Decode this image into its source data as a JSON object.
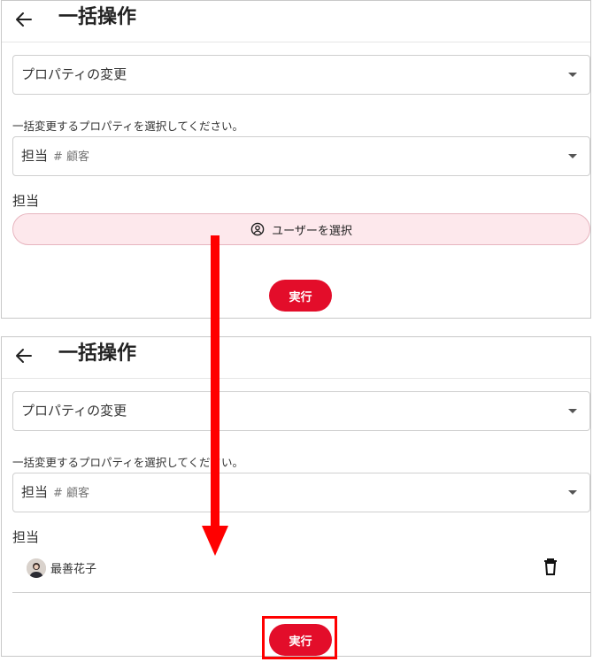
{
  "screen_before": {
    "header": {
      "title": "一括操作"
    },
    "action_select": {
      "value": "プロパティの変更"
    },
    "help_text": "一括変更するプロパティを選択してください。",
    "property_select": {
      "value": "担当",
      "hint": "# 顧客"
    },
    "field_label": "担当",
    "select_user_button": {
      "label": "ユーザーを選択",
      "icon": "user-circle-icon"
    },
    "run_button": {
      "label": "実行"
    }
  },
  "screen_after": {
    "header": {
      "title": "一括操作"
    },
    "action_select": {
      "value": "プロパティの変更"
    },
    "help_text": "一括変更するプロパティを選択してください。",
    "property_select": {
      "value": "担当",
      "hint": "# 顧客"
    },
    "field_label": "担当",
    "selected_user": {
      "name": "最善花子",
      "icon": "avatar"
    },
    "delete_icon": "trash-icon",
    "run_button": {
      "label": "実行"
    }
  },
  "colors": {
    "accent": "#e30d2a",
    "select_user_bg": "#fde8ec",
    "annotation": "#ff0000"
  }
}
